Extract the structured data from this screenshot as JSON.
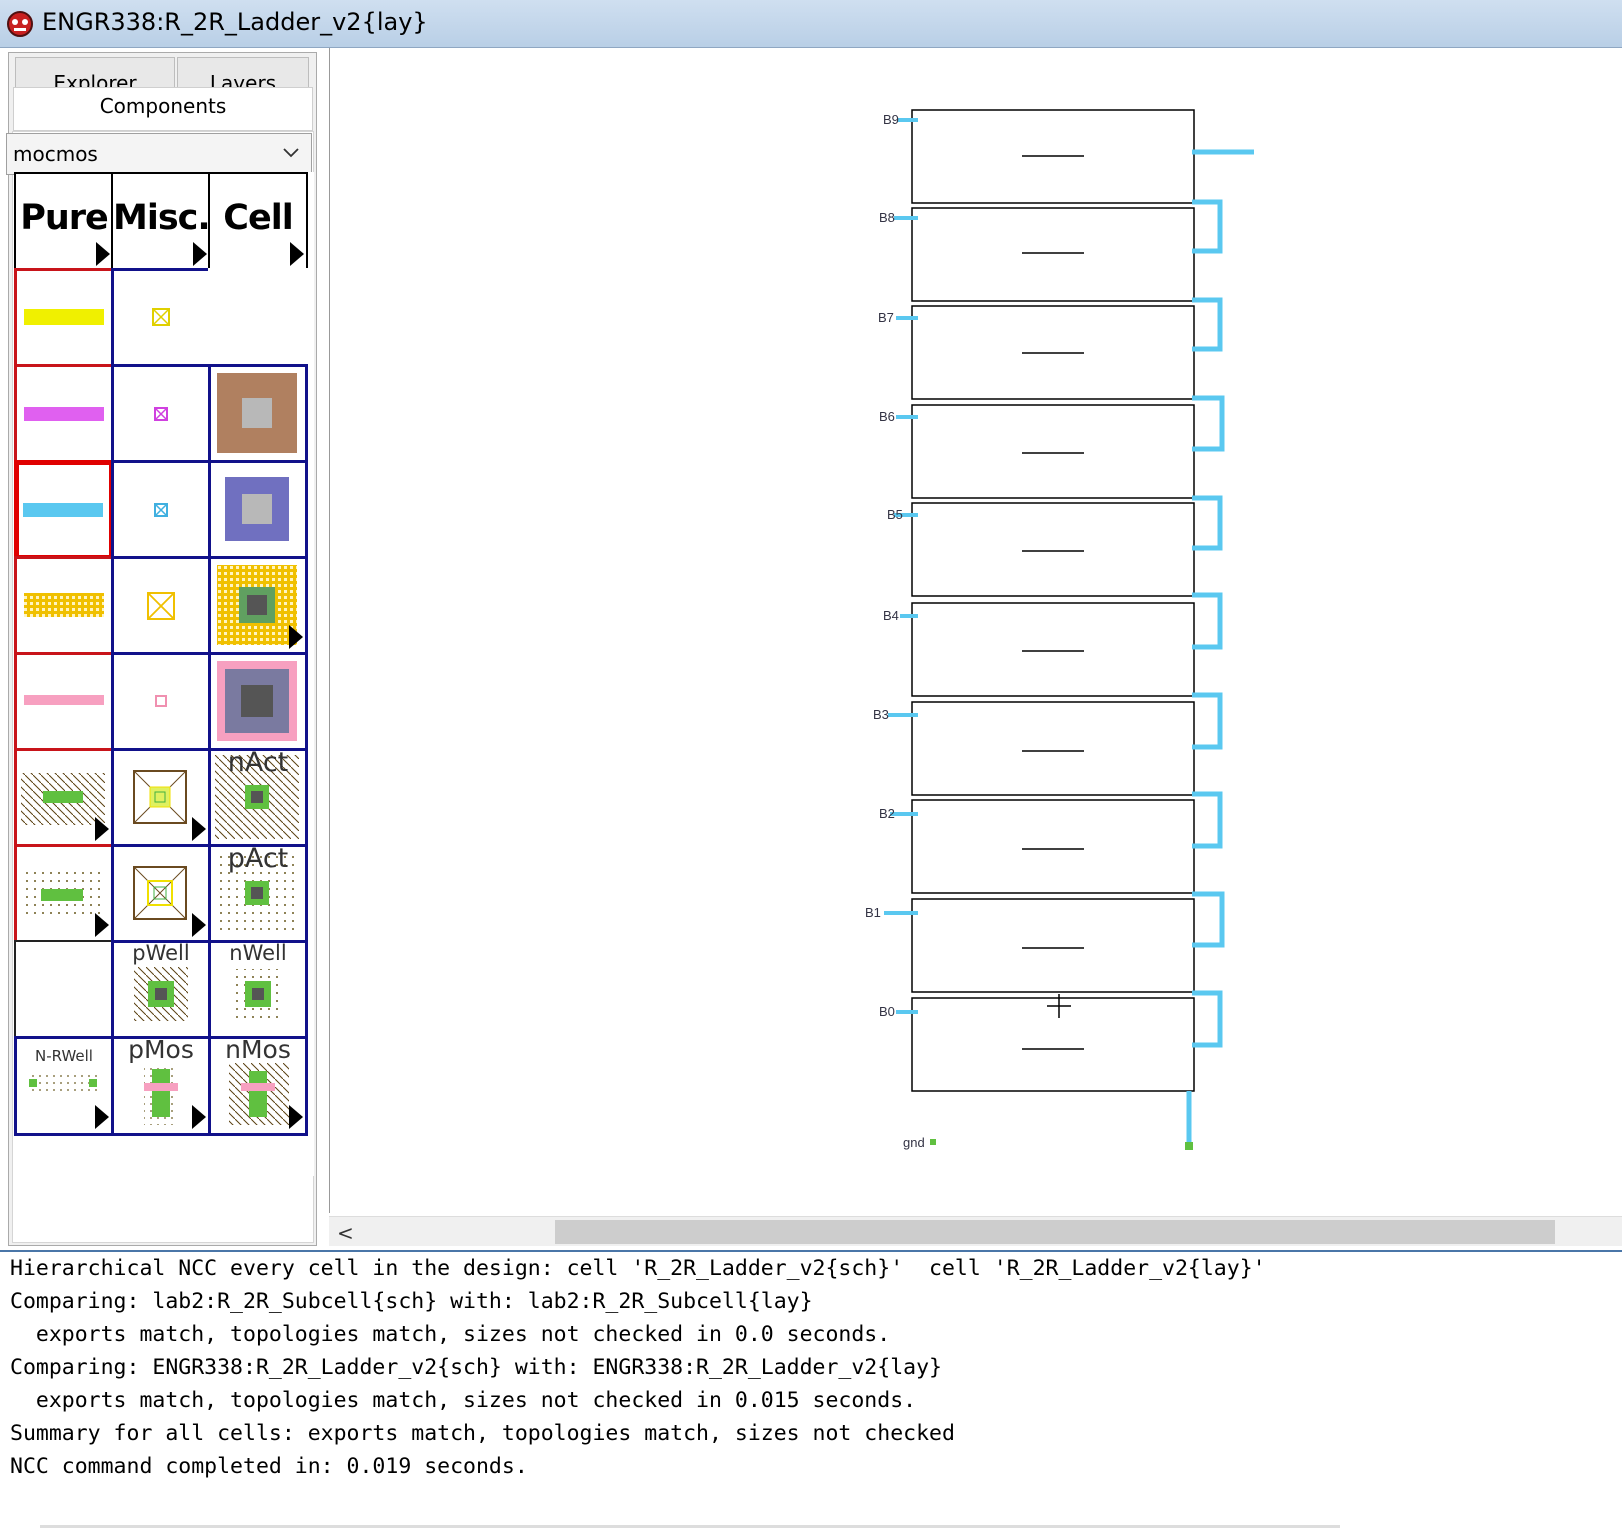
{
  "window": {
    "title": "ENGR338:R_2R_Ladder_v2{lay}",
    "icon": "electric-logo-icon"
  },
  "left_panel": {
    "tabs": [
      "Explorer",
      "Layers",
      "Components"
    ],
    "active_tab": "Components",
    "technology": "mocmos",
    "palette_headers": [
      "Pure",
      "Misc.",
      "Cell"
    ],
    "palette_labels": {
      "nact": "nAct",
      "pact": "pAct",
      "pwell": "pWell",
      "nwell": "nWell",
      "nrwell": "N-RWell",
      "pmos": "pMos",
      "nmos": "nMos"
    },
    "colors": {
      "metal1": "#5ac8f0",
      "poly": "#e060f0",
      "polysilicon1": "#f0f000",
      "active": "#f0c000",
      "contact_brown": "#b08060",
      "contact_blue": "#7070c0",
      "pink": "#f7a0c0",
      "border_blue": "#11118a",
      "border_red": "#c8141a"
    }
  },
  "layout": {
    "bit_labels": [
      "B9",
      "B8",
      "B7",
      "B6",
      "B5",
      "B4",
      "B3",
      "B2",
      "B1",
      "B0"
    ],
    "ground_label": "gnd",
    "wire_color": "#5ac8f0"
  },
  "scrollbar": {
    "left_arrow": "<"
  },
  "console": {
    "lines": [
      "Hierarchical NCC every cell in the design: cell 'R_2R_Ladder_v2{sch}'  cell 'R_2R_Ladder_v2{lay}'",
      "Comparing: lab2:R_2R_Subcell{sch} with: lab2:R_2R_Subcell{lay}",
      "  exports match, topologies match, sizes not checked in 0.0 seconds.",
      "Comparing: ENGR338:R_2R_Ladder_v2{sch} with: ENGR338:R_2R_Ladder_v2{lay}",
      "  exports match, topologies match, sizes not checked in 0.015 seconds.",
      "Summary for all cells: exports match, topologies match, sizes not checked",
      "NCC command completed in: 0.019 seconds."
    ]
  }
}
